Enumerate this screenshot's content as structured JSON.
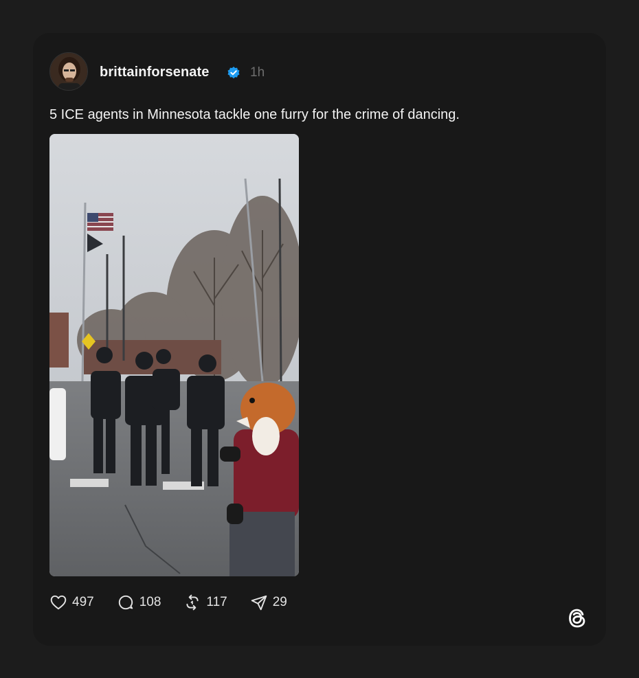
{
  "post": {
    "author": "brittainforsenate",
    "timestamp": "1h",
    "text": "5 ICE agents in Minnesota tackle one furry for the crime of dancing.",
    "verified": true
  },
  "actions": {
    "likes": "497",
    "replies": "108",
    "reposts": "117",
    "shares": "29"
  },
  "icons": {
    "verified": "verified-badge-icon",
    "like": "heart-icon",
    "reply": "speech-bubble-icon",
    "repost": "repost-icon",
    "share": "send-icon",
    "brand": "threads-logo-icon"
  },
  "colors": {
    "background": "#1c1c1c",
    "card": "#181818",
    "text": "#f3f3f3",
    "muted": "#6e6e6e",
    "verified": "#1d9bf0"
  }
}
